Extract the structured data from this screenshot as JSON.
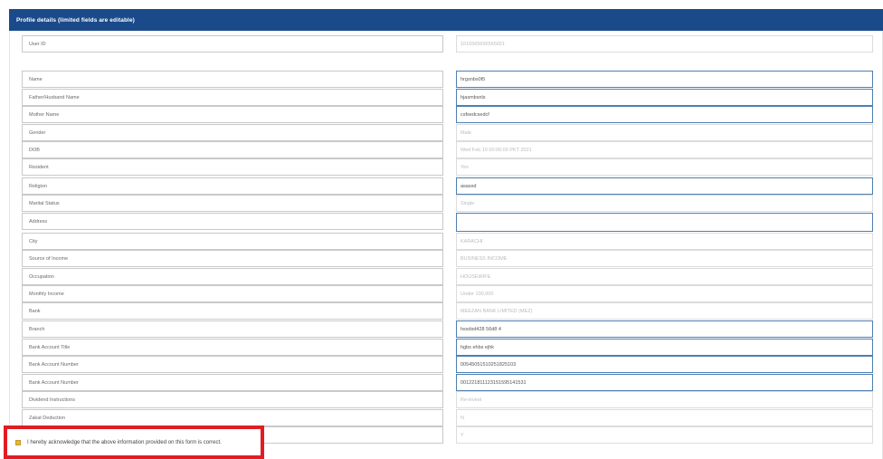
{
  "header": {
    "title": "Profile details (limited fields are editable)"
  },
  "fields": [
    {
      "label": "User ID",
      "value": "1016565656565651",
      "editable": false
    },
    {
      "label": "Name",
      "value": "hrgsnbs0t5",
      "editable": true
    },
    {
      "label": "Father/Husband Name",
      "value": "hjasmbsnls",
      "editable": true
    },
    {
      "label": "Mother Name",
      "value": "csfsedcsedcf",
      "editable": true
    },
    {
      "label": "Gender",
      "value": "Male",
      "editable": false
    },
    {
      "label": "DOB",
      "value": "Wed Feb 10 00:00:00 PKT 2021",
      "editable": false
    },
    {
      "label": "Resident",
      "value": "Yes",
      "editable": false
    },
    {
      "label": "Religion",
      "value": "asasxd",
      "editable": true
    },
    {
      "label": "Marital Status",
      "value": "Single",
      "editable": false
    },
    {
      "label": "Address",
      "value": "",
      "editable": true
    },
    {
      "label": "City",
      "value": "KARACHI",
      "editable": false
    },
    {
      "label": "Source of Income",
      "value": "BUSINESS INCOME",
      "editable": false
    },
    {
      "label": "Occupation",
      "value": "HOUSEWIFE",
      "editable": false
    },
    {
      "label": "Monthly Income",
      "value": "Under 100,000",
      "editable": false
    },
    {
      "label": "Bank",
      "value": "MEEZAN BANK LIMITED (MEZ)",
      "editable": false
    },
    {
      "label": "Branch",
      "value": "hssdsd428 56d8 4",
      "editable": true
    },
    {
      "label": "Bank Account Title",
      "value": "hgbs ehbs ejhk",
      "editable": true
    },
    {
      "label": "Bank Account Number",
      "value": "00545051510251825103",
      "editable": true
    },
    {
      "label": "Bank Account Number",
      "value": "001221811123151595141531",
      "editable": true
    },
    {
      "label": "Dividend Instructions",
      "value": "Re-invest",
      "editable": false
    },
    {
      "label": "Zakat Deduction",
      "value": "N",
      "editable": false
    },
    {
      "label": "",
      "value": "Y",
      "editable": false
    }
  ],
  "acknowledgement": {
    "text": "I hereby acknowledge that the above information provided on this form is correct."
  },
  "colors": {
    "header_bg": "#1a4a8a",
    "editable_border": "#4e7fb1",
    "highlight": "#e11d24",
    "checkbox": "#e7b43a"
  }
}
